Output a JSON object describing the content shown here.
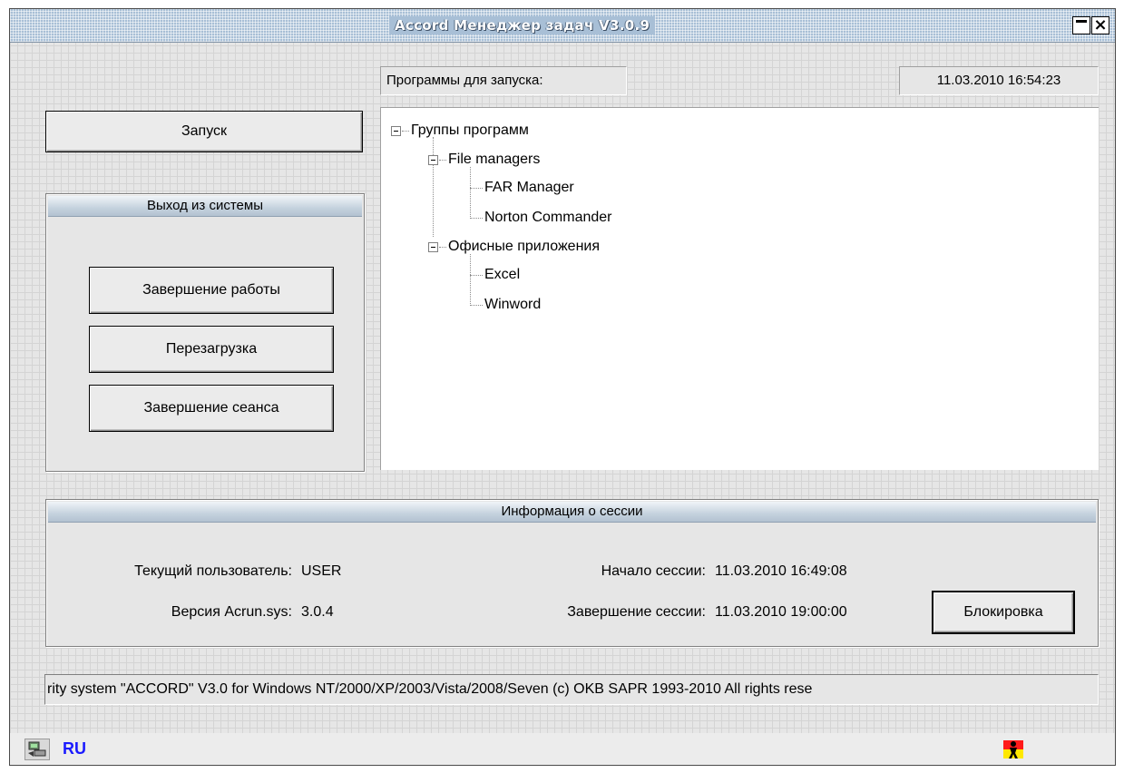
{
  "window": {
    "title": "Accord Менеджер задач V3.0.9",
    "minimize_glyph": "",
    "close_glyph": "×"
  },
  "programs_label": "Программы для запуска:",
  "datetime": "11.03.2010 16:54:23",
  "launch_button": "Запуск",
  "logout_panel": {
    "title": "Выход из системы",
    "buttons": [
      "Завершение работы",
      "Перезагрузка",
      "Завершение сеанса"
    ]
  },
  "tree": {
    "root": "Группы программ",
    "groups": [
      {
        "label": "File managers",
        "items": [
          "FAR Manager",
          "Norton Commander"
        ]
      },
      {
        "label": "Офисные приложения",
        "items": [
          "Excel",
          "Winword"
        ]
      }
    ]
  },
  "session": {
    "title": "Информация о сессии",
    "user_label": "Текущий пользователь:",
    "user_value": "USER",
    "version_label": "Версия Acrun.sys:",
    "version_value": "3.0.4",
    "start_label": "Начало сессии:",
    "start_value": "11.03.2010 16:49:08",
    "end_label": "Завершение сессии:",
    "end_value": "11.03.2010 19:00:00",
    "lock_button": "Блокировка"
  },
  "status_text": "rity system \"ACCORD\" V3.0 for Windows NT/2000/XP/2003/Vista/2008/Seven (c) OKB SAPR 1993-2010 All rights rese",
  "taskbar": {
    "language": "RU",
    "language_color": "#1a1aff",
    "left_icon": "network-computer-icon",
    "right_icon": "accord-person-icon"
  }
}
